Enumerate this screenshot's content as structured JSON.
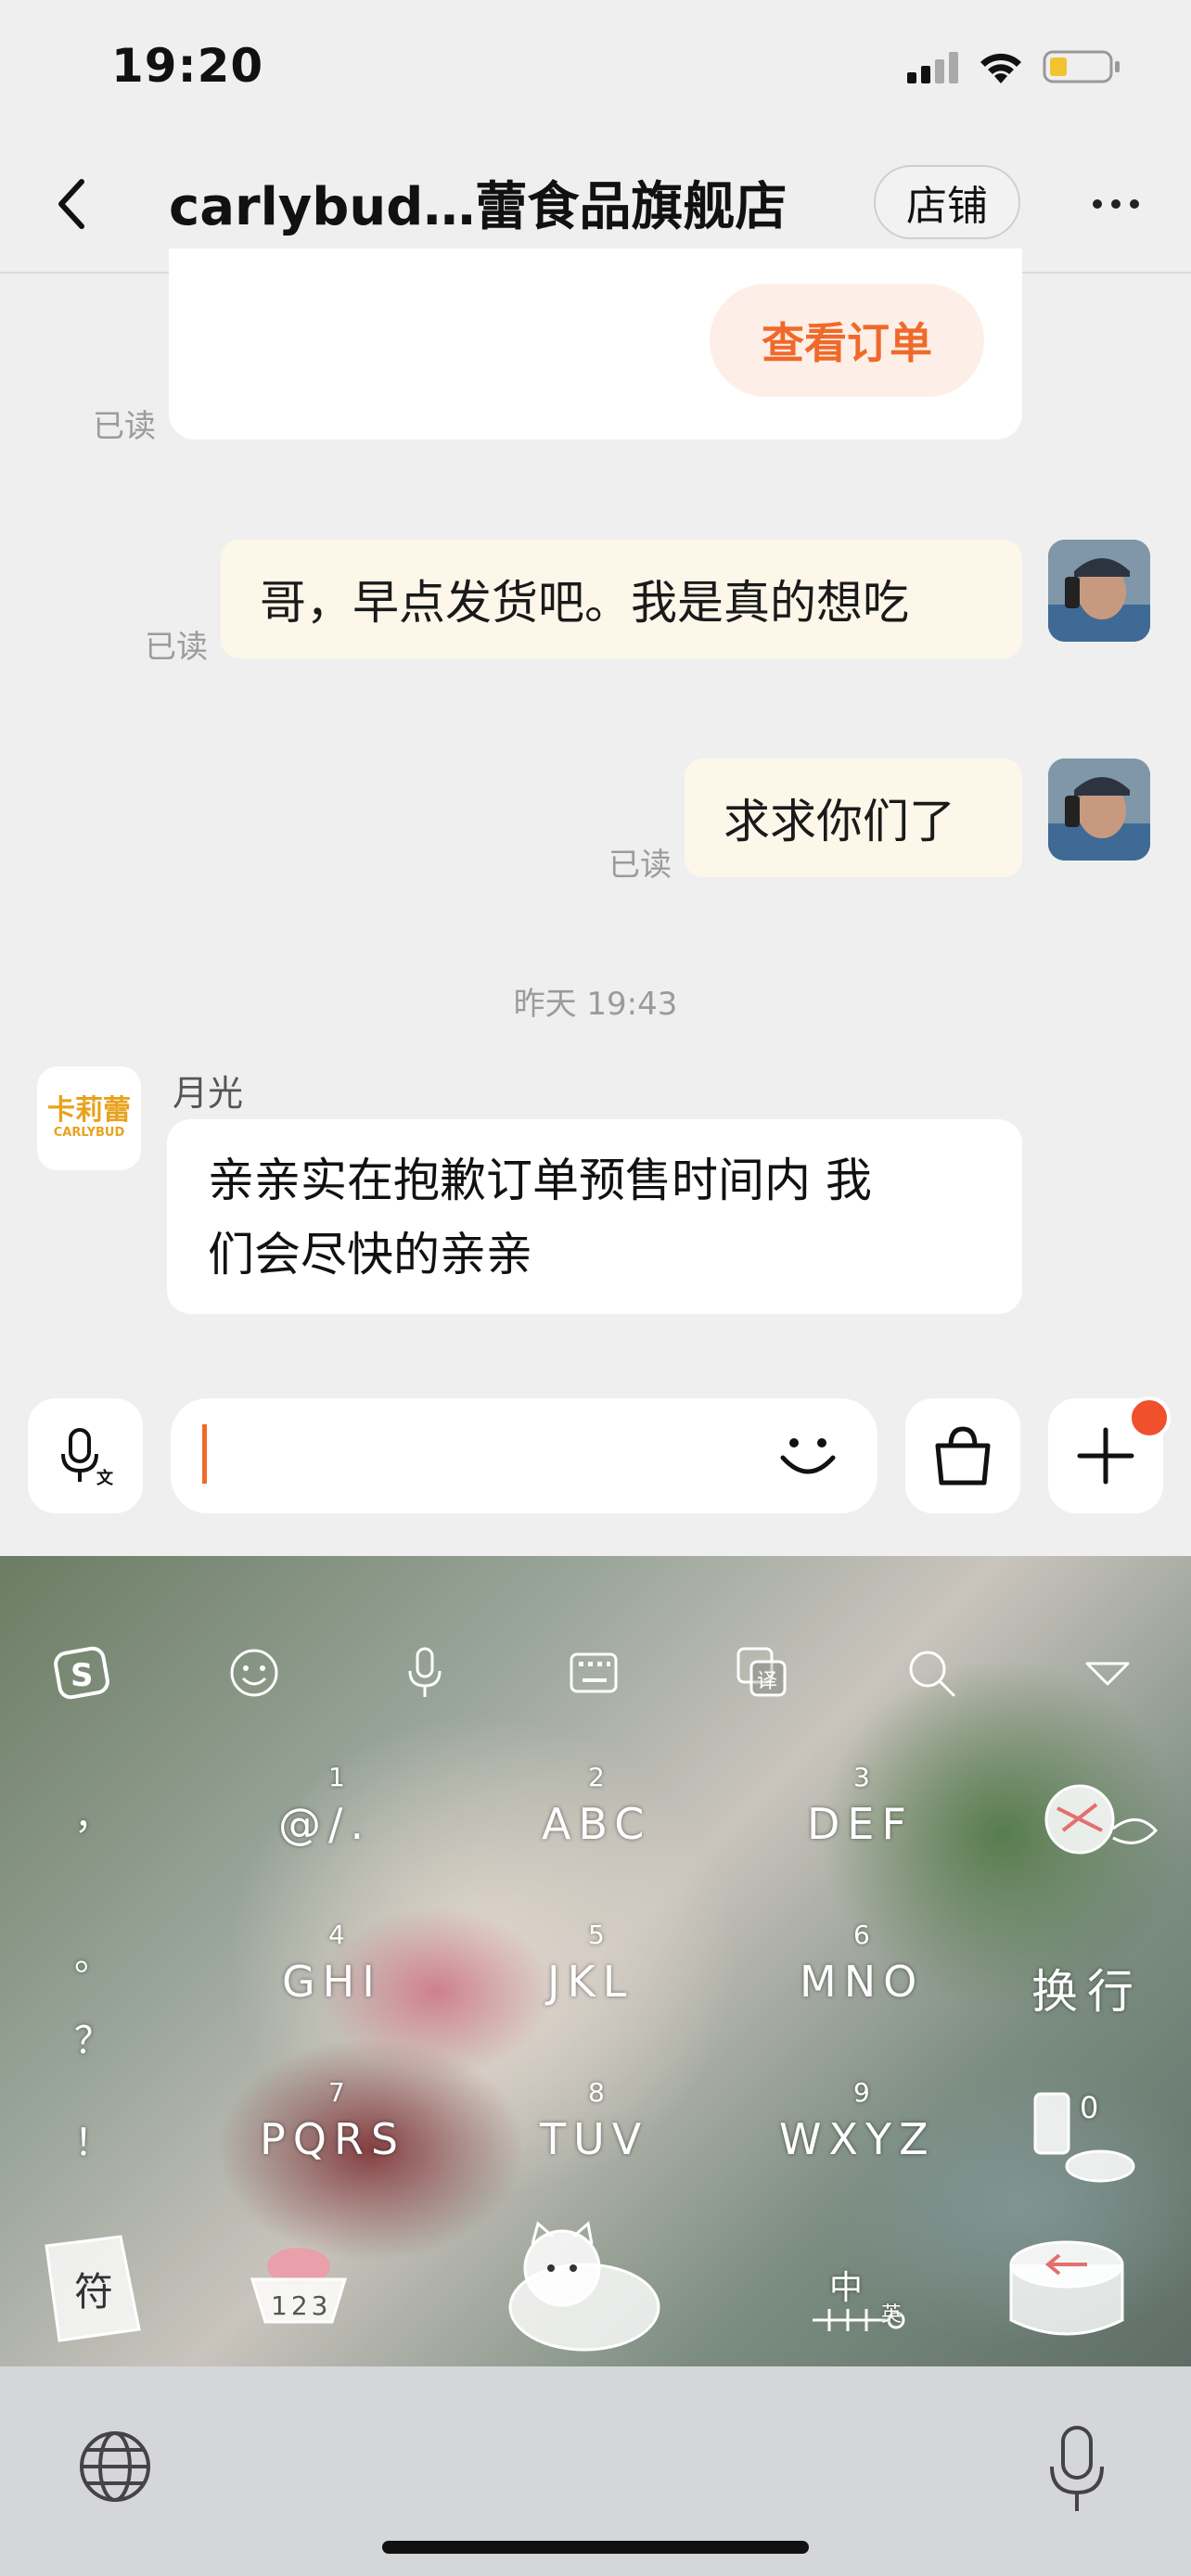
{
  "status_bar": {
    "time": "19:20"
  },
  "nav": {
    "title": "carlybud…蕾食品旗舰店",
    "shop_button": "店铺",
    "more_icon": "more-icon"
  },
  "order_card": {
    "button": "查看订单",
    "read": "已读"
  },
  "messages": [
    {
      "text": "哥，早点发货吧。我是真的想吃",
      "read": "已读"
    },
    {
      "text": "求求你们了",
      "read": "已读"
    }
  ],
  "timestamp": "昨天 19:43",
  "store": {
    "avatar_line1": "卡莉蕾",
    "avatar_line2": "CARLYBUD",
    "sender": "月光",
    "reply_line1": "亲亲实在抱歉订单预售时间内 我",
    "reply_line2": "们会尽快的亲亲"
  },
  "keyboard": {
    "keys": [
      {
        "num": "1",
        "letters": "@/."
      },
      {
        "num": "2",
        "letters": "ABC"
      },
      {
        "num": "3",
        "letters": "DEF"
      },
      {
        "num": "4",
        "letters": "GHI"
      },
      {
        "num": "5",
        "letters": "JKL"
      },
      {
        "num": "6",
        "letters": "MNO"
      },
      {
        "num": "7",
        "letters": "PQRS"
      },
      {
        "num": "8",
        "letters": "TUV"
      },
      {
        "num": "9",
        "letters": "WXYZ"
      }
    ],
    "enter": "换行",
    "zero": "0",
    "symbols": "符",
    "numbers": "123",
    "lang_cn": "中",
    "lang_en": "英",
    "punct_comma": "，",
    "punct_period": "。",
    "punct_question": "？",
    "punct_exclaim": "！"
  },
  "colors": {
    "accent": "#ef6a2a",
    "bubble": "#fdf7ea",
    "badge": "#f0502b"
  }
}
